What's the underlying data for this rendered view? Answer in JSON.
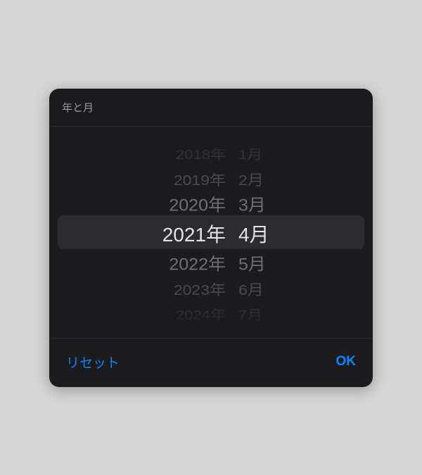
{
  "dialog": {
    "title": "年と月"
  },
  "picker": {
    "years": {
      "items": [
        "2018年",
        "2019年",
        "2020年",
        "2021年",
        "2022年",
        "2023年",
        "2024年"
      ],
      "selectedIndex": 3
    },
    "months": {
      "items": [
        "1月",
        "2月",
        "3月",
        "4月",
        "5月",
        "6月",
        "7月"
      ],
      "selectedIndex": 3
    }
  },
  "footer": {
    "reset": "リセット",
    "ok": "OK"
  },
  "colors": {
    "accent": "#0a84ff",
    "dialogBg": "#1c1c1e",
    "selectionBg": "#2c2c2e"
  }
}
